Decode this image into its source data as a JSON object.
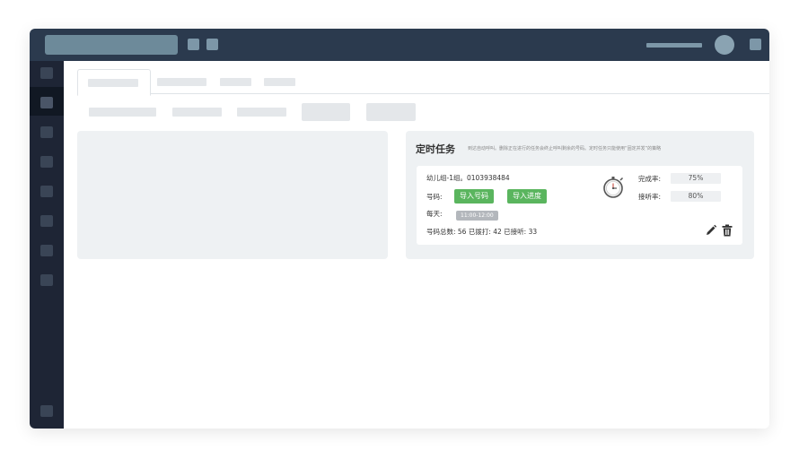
{
  "task_panel": {
    "title": "定时任务",
    "description": "到达自动呼叫。删除正在进行的任务会终止呼叫剩余的号码。定时任务只能使用“固定并发”的策略"
  },
  "task_card": {
    "name": "幼儿组-1组。0103938484",
    "number_label": "号码:",
    "import_numbers_button": "导入号码",
    "import_progress_button": "导入进度",
    "daily_label": "每天:",
    "time_range": "11:00-12:00",
    "stats": "号码总数: 56  已拨打: 42  已接听: 33",
    "completion_label": "完成率:",
    "completion_value": "75%",
    "answer_label": "接听率:",
    "answer_value": "80%"
  },
  "icons": {
    "stopwatch": "stopwatch-icon",
    "edit": "pencil-icon",
    "delete": "trash-icon"
  },
  "colors": {
    "topbar": "#2b3a4e",
    "sidebar": "#1e2535",
    "accent_green": "#5ab55e",
    "panel_bg": "#eef1f3"
  }
}
